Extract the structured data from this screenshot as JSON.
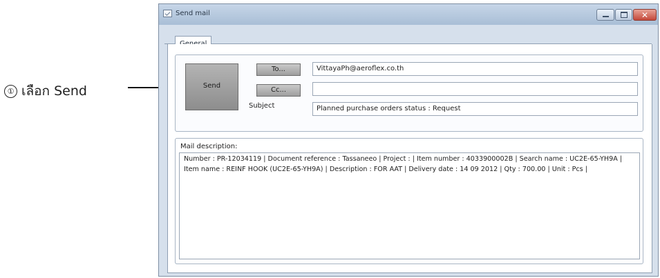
{
  "callout": {
    "number": "①",
    "text": "เลือก Send"
  },
  "window": {
    "title": "Send mail",
    "icon": "document-check-icon",
    "controls": [
      "minimize-icon",
      "maximize-icon",
      "close-icon"
    ]
  },
  "tabs": [
    {
      "label": "General",
      "active": true
    }
  ],
  "form": {
    "send_label": "Send",
    "to_label": "To...",
    "cc_label": "Cc...",
    "subject_label": "Subject",
    "to_value": "VittayaPh@aeroflex.co.th",
    "cc_value": "",
    "subject_value": "Planned purchase orders status : Request"
  },
  "description": {
    "label": "Mail description:",
    "text": "Number : PR-12034119 | Document reference : Tassaneeo | Project : | Item number : 4033900002B | Search name : UC2E-65-YH9A | Item name : REINF HOOK (UC2E-65-YH9A) | Description : FOR AAT | Delivery date : 14 09 2012 | Qty : 700.00 | Unit : Pcs |"
  },
  "colors": {
    "titlebar": "#b8c9de",
    "close_button": "#c4483a",
    "send_button": "#9d9d9d"
  }
}
